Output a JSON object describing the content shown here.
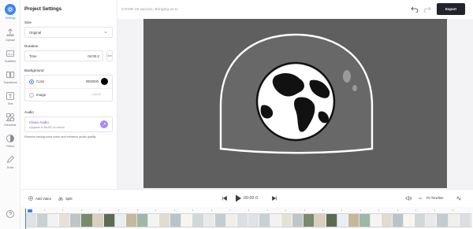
{
  "rail": {
    "items": [
      {
        "label": "Settings",
        "icon": "gear-icon",
        "active": true
      },
      {
        "label": "Upload",
        "icon": "upload-icon"
      },
      {
        "label": "Subtitles",
        "icon": "subtitles-icon"
      },
      {
        "label": "Transitions",
        "icon": "transitions-icon"
      },
      {
        "label": "Text",
        "icon": "text-icon"
      },
      {
        "label": "Elements",
        "icon": "elements-icon"
      },
      {
        "label": "Filters",
        "icon": "filters-icon"
      },
      {
        "label": "Draw",
        "icon": "pencil-icon"
      }
    ],
    "help_icon": "help-icon"
  },
  "panel": {
    "title": "Project Settings",
    "size": {
      "label": "Size",
      "value": "Original"
    },
    "duration": {
      "label": "Duration",
      "field_label": "Time",
      "value": "04:00.2"
    },
    "background": {
      "label": "Background",
      "color_label": "Color",
      "color_value": "#000000",
      "image_label": "Image",
      "image_upload": "Upload"
    },
    "audio": {
      "label": "Audio",
      "clean_title": "Clean Audio",
      "clean_sub": "Upgrade to BASIC to unlock",
      "note": "Remove background noise and enhance audio quality"
    }
  },
  "topbar": {
    "project_title": "COVID-19 vaccine, Bringing us to",
    "export_label": "Export"
  },
  "player": {
    "add_video": "Add Video",
    "split": "Split",
    "time": "00:00.0",
    "fit_timeline": "Fit Timeline"
  },
  "timeline": {
    "ruler_labels": [
      "0",
      "10",
      "20",
      "30",
      "40",
      "50",
      "60",
      "70",
      "80",
      "90",
      "100",
      "110",
      "120",
      "130",
      "140",
      "150",
      "160",
      "170",
      "180",
      "190",
      "200",
      "210",
      "220",
      "230"
    ]
  },
  "colors": {
    "accent": "#3b82f6",
    "export_bg": "#23232b",
    "canvas": "#5f5f5f",
    "clean_audio": "#7c4ddb"
  }
}
